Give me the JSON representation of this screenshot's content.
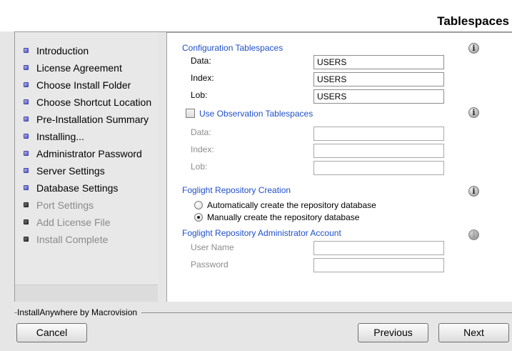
{
  "header": {
    "title": "Tablespaces"
  },
  "steps": [
    {
      "label": "Introduction",
      "state": "done"
    },
    {
      "label": "License Agreement",
      "state": "done"
    },
    {
      "label": "Choose Install Folder",
      "state": "done"
    },
    {
      "label": "Choose Shortcut Location",
      "state": "done"
    },
    {
      "label": "Pre-Installation Summary",
      "state": "done"
    },
    {
      "label": "Installing...",
      "state": "done"
    },
    {
      "label": "Administrator Password",
      "state": "done"
    },
    {
      "label": "Server Settings",
      "state": "done"
    },
    {
      "label": "Database Settings",
      "state": "done"
    },
    {
      "label": "Port Settings",
      "state": "todo"
    },
    {
      "label": "Add License File",
      "state": "todo"
    },
    {
      "label": "Install Complete",
      "state": "todo"
    }
  ],
  "config": {
    "title": "Configuration Tablespaces",
    "data_label": "Data:",
    "data_value": "USERS",
    "index_label": "Index:",
    "index_value": "USERS",
    "lob_label": "Lob:",
    "lob_value": "USERS"
  },
  "observation": {
    "checkbox_label": "Use Observation Tablespaces",
    "checked": false,
    "data_label": "Data:",
    "data_value": "",
    "index_label": "Index:",
    "index_value": "",
    "lob_label": "Lob:",
    "lob_value": ""
  },
  "repository": {
    "title": "Foglight Repository Creation",
    "option_auto": "Automatically create the repository database",
    "option_manual": "Manually create the repository database",
    "selected": "manual"
  },
  "admin_account": {
    "title": "Foglight Repository Administrator Account",
    "username_label": "User Name",
    "username_value": "",
    "password_label": "Password",
    "password_value": ""
  },
  "info_icon_glyph": "i",
  "footer": {
    "brand": "InstallAnywhere by Macrovision",
    "cancel_label": "Cancel",
    "previous_label": "Previous",
    "next_label": "Next"
  }
}
